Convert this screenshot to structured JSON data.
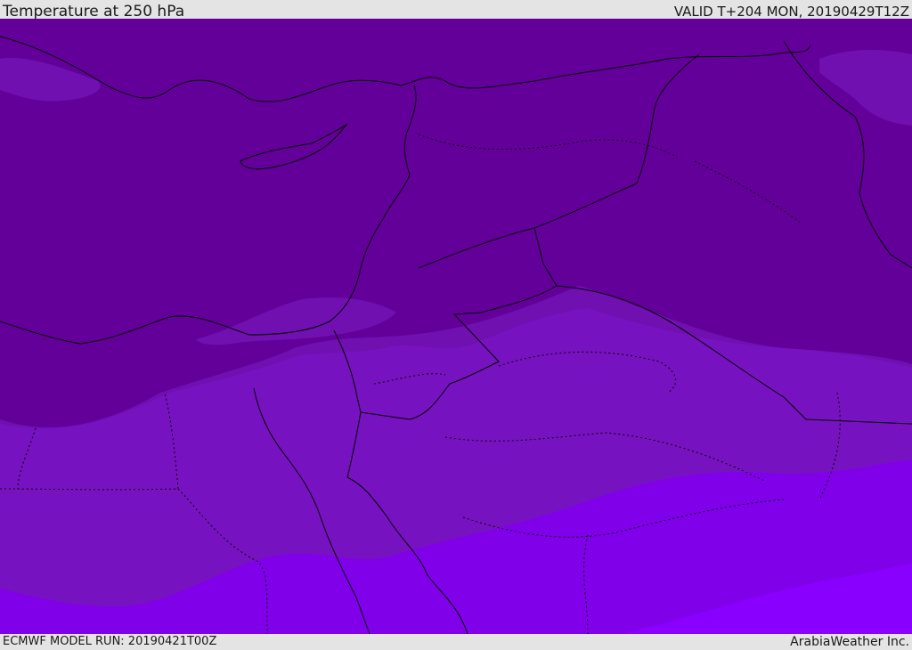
{
  "header": {
    "title": "Temperature at 250 hPa",
    "valid": "VALID T+204 MON, 20190429T12Z"
  },
  "footer": {
    "model_run": "ECMWF MODEL RUN: 20190421T00Z",
    "credit": "ArabiaWeather Inc."
  },
  "colors": {
    "band_coldest": "#63009a",
    "band_cold": "#7010b0",
    "band_mid": "#7712c0",
    "band_warm": "#8000ea",
    "band_warmest": "#8a00ff",
    "boundary_line": "#000000"
  }
}
